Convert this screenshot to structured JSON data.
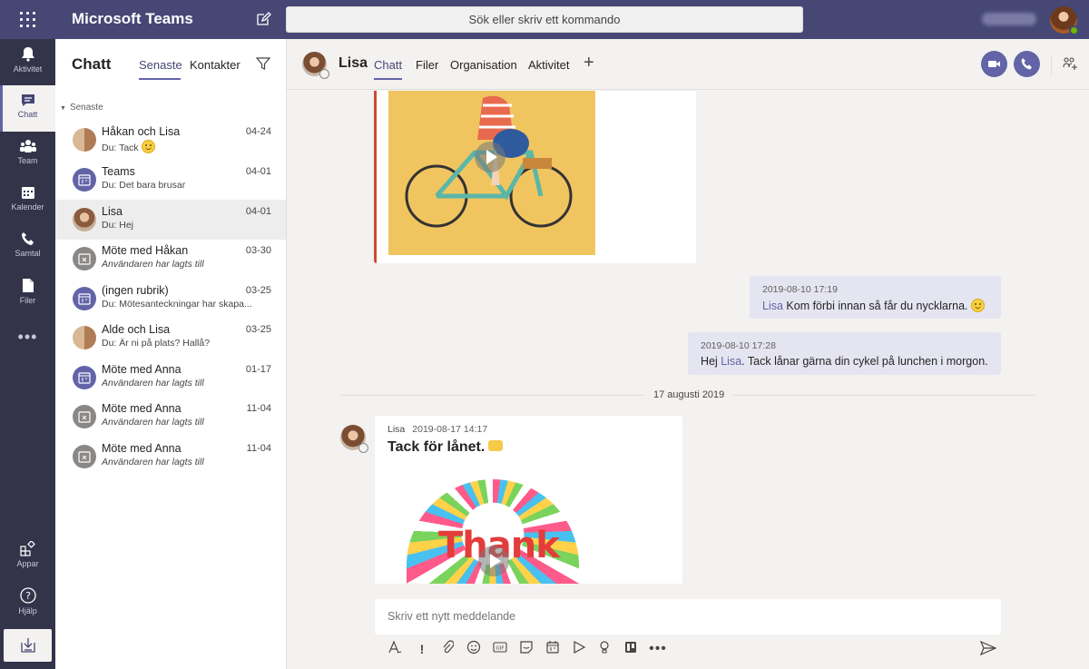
{
  "topbar": {
    "app_title": "Microsoft Teams",
    "search_placeholder": "Sök eller skriv ett kommando"
  },
  "rail": {
    "items": [
      {
        "label": "Aktivitet",
        "icon": "bell-icon"
      },
      {
        "label": "Chatt",
        "icon": "chat-icon"
      },
      {
        "label": "Team",
        "icon": "team-icon"
      },
      {
        "label": "Kalender",
        "icon": "calendar-icon"
      },
      {
        "label": "Samtal",
        "icon": "phone-icon"
      },
      {
        "label": "Filer",
        "icon": "file-icon"
      }
    ],
    "more": "•••",
    "apps_label": "Appar",
    "help_label": "Hjälp"
  },
  "list": {
    "title": "Chatt",
    "tab_recent": "Senaste",
    "tab_contacts": "Kontakter",
    "section": "Senaste",
    "chats": [
      {
        "name": "Håkan och Lisa",
        "preview": "Du: Tack",
        "date": "04-24",
        "italic": false
      },
      {
        "name": "Teams",
        "preview": "Du: Det bara brusar",
        "date": "04-01",
        "italic": false
      },
      {
        "name": "Lisa",
        "preview": "Du: Hej",
        "date": "04-01",
        "italic": false
      },
      {
        "name": "Möte med Håkan",
        "preview": "Användaren har lagts till",
        "date": "03-30",
        "italic": true
      },
      {
        "name": "(ingen rubrik)",
        "preview": "Du: Mötesanteckningar har skapa...",
        "date": "03-25",
        "italic": false
      },
      {
        "name": "Alde och Lisa",
        "preview": "Du: Är ni på plats? Hallå?",
        "date": "03-25",
        "italic": false
      },
      {
        "name": "Möte med Anna",
        "preview": "Användaren har lagts till",
        "date": "01-17",
        "italic": true
      },
      {
        "name": "Möte med Anna",
        "preview": "Användaren har lagts till",
        "date": "11-04",
        "italic": true
      },
      {
        "name": "Möte med Anna",
        "preview": "Användaren har lagts till",
        "date": "11-04",
        "italic": true
      }
    ]
  },
  "conversation": {
    "name": "Lisa",
    "tabs": [
      "Chatt",
      "Filer",
      "Organisation",
      "Aktivitet"
    ],
    "messages": {
      "m1_meta": "2019-08-10 17:19",
      "m1_mention": "Lisa",
      "m1_text": " Kom förbi innan så får du nycklarna.",
      "m2_meta": "2019-08-10 17:28",
      "m2_prefix": "Hej ",
      "m2_mention": "Lisa",
      "m2_text": ". Tack lånar gärna din cykel på lunchen i morgon.",
      "date_divider": "17 augusti 2019",
      "m3_sender": "Lisa",
      "m3_time": "2019-08-17 14:17",
      "m3_text": "Tack för lånet.",
      "m3_gif_text": "Thank"
    },
    "composer_placeholder": "Skriv ett nytt meddelande"
  },
  "colors": {
    "brand": "#464775",
    "accent": "#6264a7",
    "rail": "#33344a",
    "mine_bubble": "#e5e5f1"
  }
}
